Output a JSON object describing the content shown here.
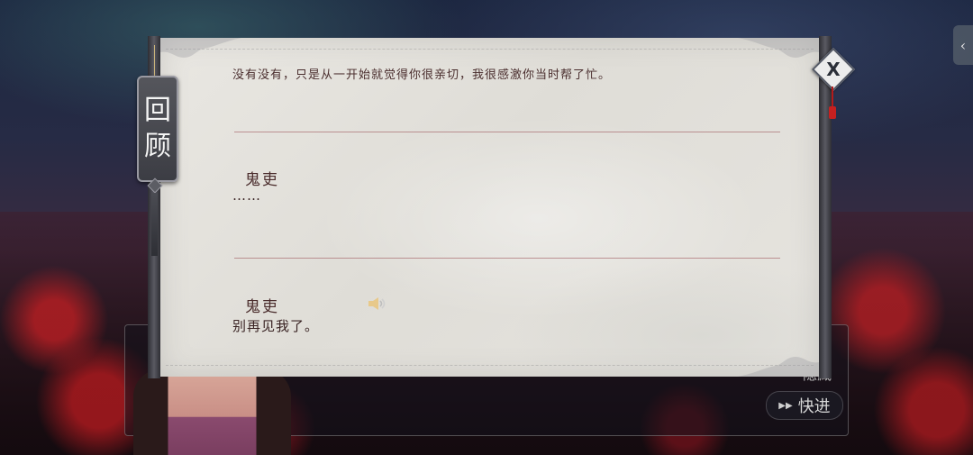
{
  "dialog": {
    "fast_forward_label": "快进",
    "hidden_button_label": "隐藏"
  },
  "review": {
    "title_chars": [
      "回",
      "顾"
    ],
    "close_label": "X",
    "entries": [
      {
        "speaker": "",
        "text": "没有没有，只是从一开始就觉得你很亲切，我很感激你当时帮了忙。"
      },
      {
        "speaker": "鬼吏",
        "text": "……"
      },
      {
        "speaker": "鬼吏",
        "text": "别再见我了。"
      }
    ]
  },
  "icons": {
    "close": "close-icon",
    "voice": "speaker-icon",
    "fast_forward": "fast-forward-icon",
    "side_tab": "chevron-left-icon"
  },
  "colors": {
    "paper": "#e9e7e2",
    "divider": "#a05a5f",
    "speaker_text": "#4a2c2c",
    "accent_red": "#c62020"
  }
}
